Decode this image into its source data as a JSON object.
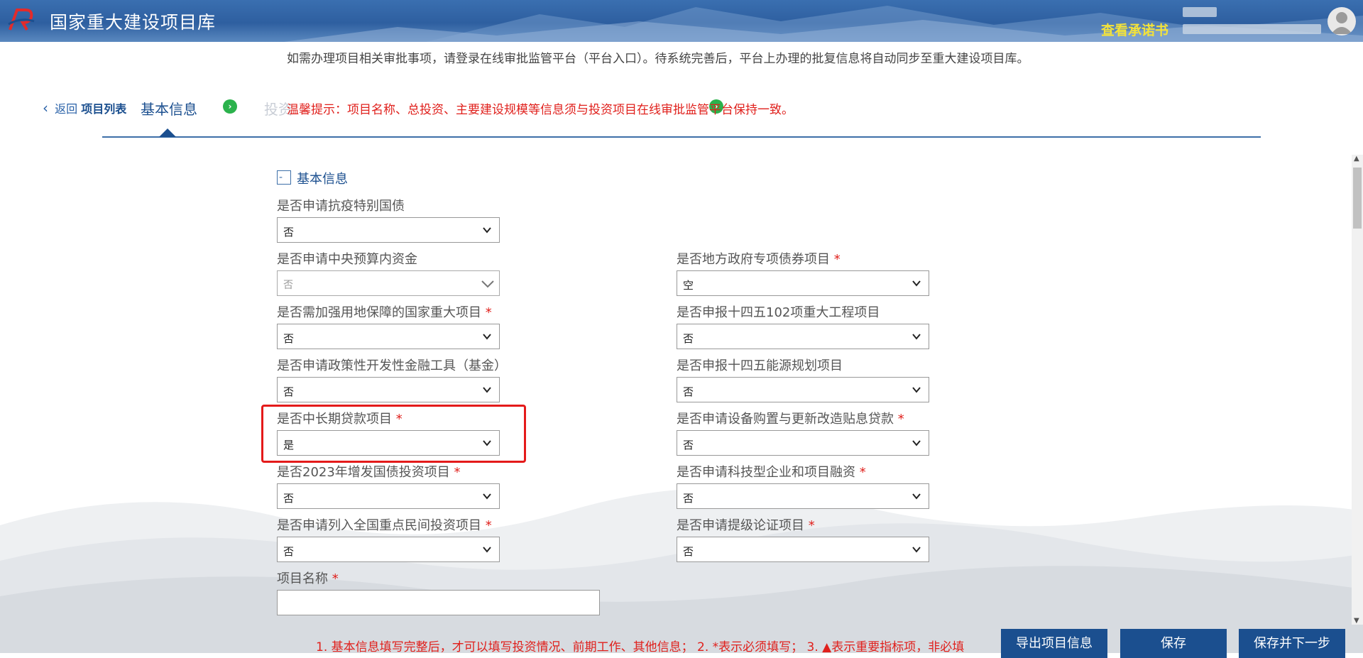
{
  "header": {
    "app_title": "国家重大建设项目库",
    "commitment_link": "查看承诺书"
  },
  "notice": {
    "text": "如需办理项目相关审批事项，请登录在线审批监管平台（平台入口）。待系统完善后，平台上办理的批复信息将自动同步至重大建设项目库。",
    "warning": "温馨提示：项目名称、总投资、主要建设规模等信息须与投资项目在线审批监管平台保持一致。"
  },
  "nav": {
    "back_label": "返回",
    "project_list_label": "项目列表",
    "active_tab": "基本信息",
    "faded_tab": "投资"
  },
  "section": {
    "title": "基本信息",
    "toggle": "-"
  },
  "fields": {
    "f1": {
      "label": "是否申请抗疫特别国债",
      "value": "否",
      "required": false
    },
    "f2": {
      "label": "是否申请中央预算内资金",
      "value": "否",
      "required": false
    },
    "f3": {
      "label": "是否地方政府专项债券项目",
      "value": "空",
      "required": true
    },
    "f4": {
      "label": "是否需加强用地保障的国家重大项目",
      "value": "否",
      "required": true
    },
    "f5": {
      "label": "是否申报十四五102项重大工程项目",
      "value": "否",
      "required": false
    },
    "f6": {
      "label": "是否申请政策性开发性金融工具（基金）",
      "value": "否",
      "required": false
    },
    "f7": {
      "label": "是否申报十四五能源规划项目",
      "value": "否",
      "required": false
    },
    "f8": {
      "label": "是否中长期贷款项目",
      "value": "是",
      "required": true
    },
    "f9": {
      "label": "是否申请设备购置与更新改造贴息贷款",
      "value": "否",
      "required": true
    },
    "f10": {
      "label": "是否2023年增发国债投资项目",
      "value": "否",
      "required": true
    },
    "f11": {
      "label": "是否申请科技型企业和项目融资",
      "value": "否",
      "required": true
    },
    "f12": {
      "label": "是否申请列入全国重点民间投资项目",
      "value": "否",
      "required": true
    },
    "f13": {
      "label": "是否申请提级论证项目",
      "value": "否",
      "required": true
    },
    "f14": {
      "label": "项目名称",
      "value": "",
      "required": true
    }
  },
  "required_mark": "*",
  "footer": {
    "note": "1. 基本信息填写完整后，才可以填写投资情况、前期工作、其他信息； 2. *表示必须填写； 3. ▲表示重要指标项，非必填",
    "export_label": "导出项目信息",
    "save_label": "保存",
    "save_next_label": "保存并下一步"
  },
  "colors": {
    "header_blue": "#2e5fa0",
    "primary_button": "#1b4f8f",
    "required_red": "#e0201c",
    "commit_yellow": "#f3e23a",
    "step_green": "#2bb24c"
  },
  "icons": [
    "logo-icon",
    "user-avatar-icon",
    "chevron-left-icon",
    "step-arrow-icon",
    "dropdown-chevron-icon"
  ]
}
